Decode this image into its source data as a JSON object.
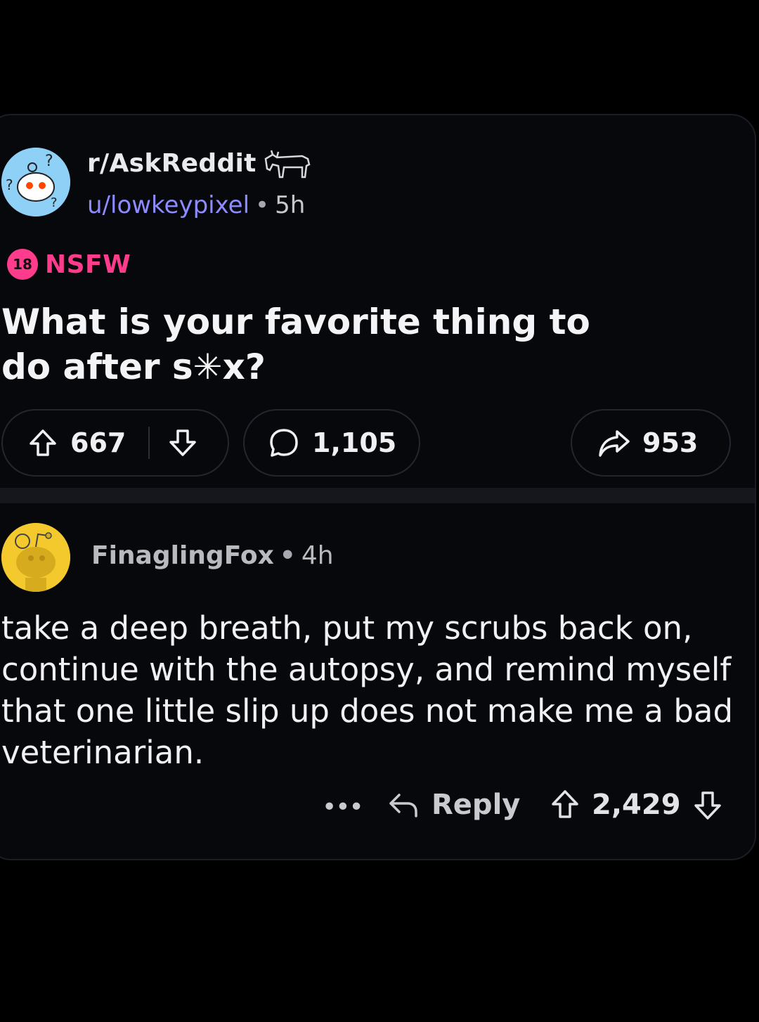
{
  "post": {
    "subreddit": "r/AskReddit",
    "subreddit_avatar_icon": "snoo-question-icon",
    "award_icon": "donkey-award-icon",
    "username": "u/lowkeypixel",
    "separator": "•",
    "age": "5h",
    "nsfw_badge": "18",
    "nsfw_label": "NSFW",
    "title": "What is your favorite thing to do after s✳x?",
    "upvotes": "667",
    "comments": "1,105",
    "shares": "953",
    "colors": {
      "username": "#8d8bff",
      "nsfw": "#ff3b8b",
      "background": "#07080c"
    }
  },
  "comment": {
    "author": "FinaglingFox",
    "separator": "•",
    "age": "4h",
    "body": "take a deep breath, put my scrubs back on, continue with the autopsy, and remind myself that one little slip up does not make me a bad veterinarian.",
    "more_label": "•••",
    "reply_label": "Reply",
    "score": "2,429",
    "avatar_icon": "snoo-avatar-icon"
  }
}
